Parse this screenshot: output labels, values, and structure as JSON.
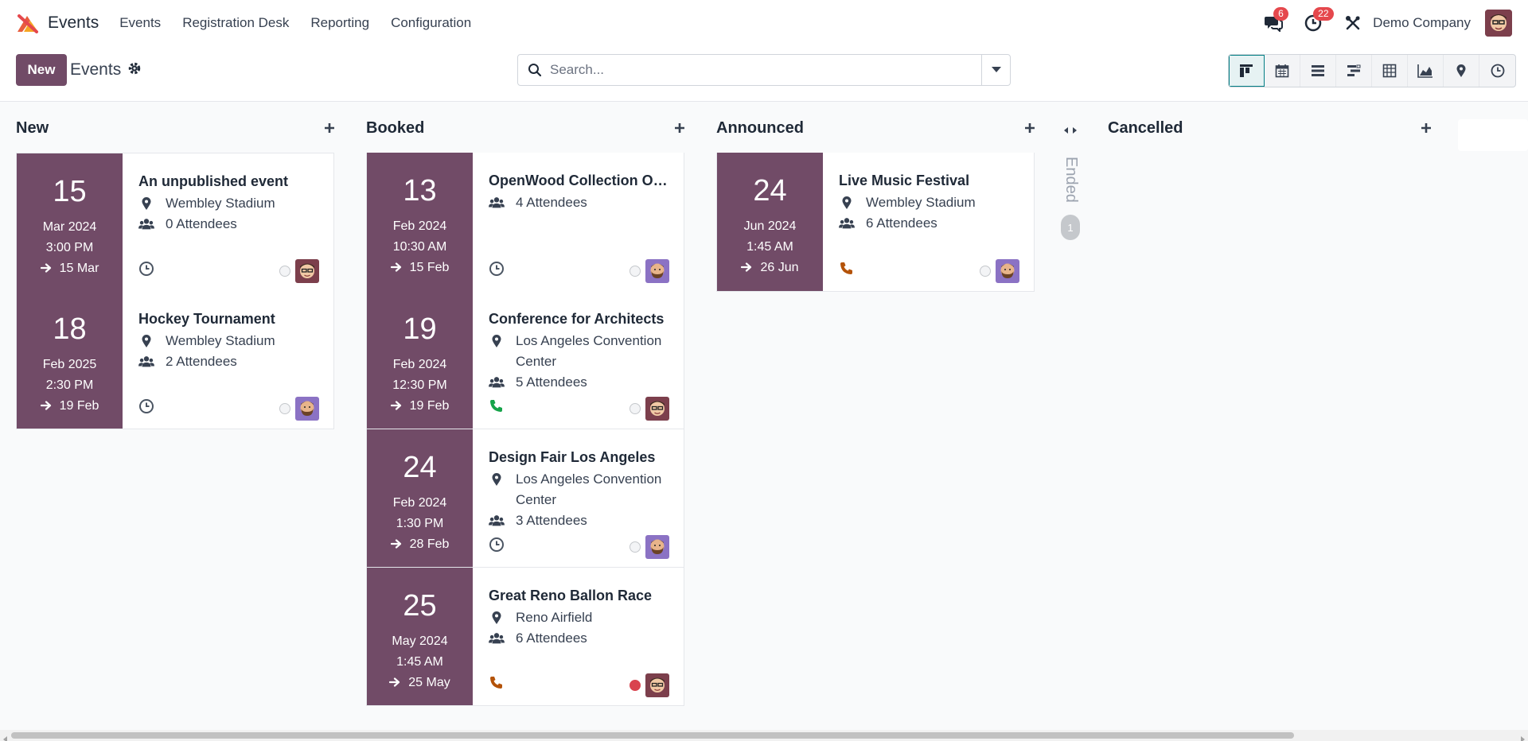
{
  "nav": {
    "app_name": "Events",
    "menu": [
      "Events",
      "Registration Desk",
      "Reporting",
      "Configuration"
    ],
    "messages_count": "6",
    "activities_count": "22",
    "company": "Demo Company"
  },
  "control": {
    "new_label": "New",
    "title": "Events",
    "search_placeholder": "Search..."
  },
  "colors": {
    "brand": "#714b67",
    "accent": "#017e84",
    "danger": "#d9434e",
    "phone_green": "#16a34a",
    "phone_orange": "#b45309"
  },
  "columns": [
    {
      "title": "New",
      "cards": [
        {
          "day": "15",
          "month": "Mar 2024",
          "time": "3:00 PM",
          "end": "15 Mar",
          "title": "An unpublished event",
          "location": "Wembley Stadium",
          "attendees": "0 Attendees",
          "activity": "clock-icon",
          "state": "normal",
          "avatar": "avatar-glasses"
        },
        {
          "day": "18",
          "month": "Feb 2025",
          "time": "2:30 PM",
          "end": "19 Feb",
          "title": "Hockey Tournament",
          "location": "Wembley Stadium",
          "attendees": "2 Attendees",
          "activity": "clock-icon",
          "state": "normal",
          "avatar": "avatar-beard"
        }
      ]
    },
    {
      "title": "Booked",
      "cards": [
        {
          "day": "13",
          "month": "Feb 2024",
          "time": "10:30 AM",
          "end": "15 Feb",
          "title": "OpenWood Collection Online Reveal",
          "location": "",
          "attendees": "4 Attendees",
          "activity": "clock-icon",
          "state": "normal",
          "avatar": "avatar-beard"
        },
        {
          "day": "19",
          "month": "Feb 2024",
          "time": "12:30 PM",
          "end": "19 Feb",
          "title": "Conference for Architects",
          "location": "Los Angeles Convention Center",
          "attendees": "5 Attendees",
          "activity": "phone-green-icon",
          "state": "normal",
          "avatar": "avatar-glasses"
        },
        {
          "day": "24",
          "month": "Feb 2024",
          "time": "1:30 PM",
          "end": "28 Feb",
          "title": "Design Fair Los Angeles",
          "location": "Los Angeles Convention Center",
          "attendees": "3 Attendees",
          "activity": "clock-icon",
          "state": "normal",
          "avatar": "avatar-beard"
        },
        {
          "day": "25",
          "month": "May 2024",
          "time": "1:45 AM",
          "end": "25 May",
          "title": "Great Reno Ballon Race",
          "location": "Reno Airfield",
          "attendees": "6 Attendees",
          "activity": "phone-orange-icon",
          "state": "blocked",
          "avatar": "avatar-glasses"
        }
      ]
    },
    {
      "title": "Announced",
      "cards": [
        {
          "day": "24",
          "month": "Jun 2024",
          "time": "1:45 AM",
          "end": "26 Jun",
          "title": "Live Music Festival",
          "location": "Wembley Stadium",
          "attendees": "6 Attendees",
          "activity": "phone-orange-icon",
          "state": "normal",
          "avatar": "avatar-beard"
        }
      ]
    }
  ],
  "folded": {
    "label": "Ended",
    "count": "1"
  },
  "cancelled": {
    "title": "Cancelled"
  }
}
